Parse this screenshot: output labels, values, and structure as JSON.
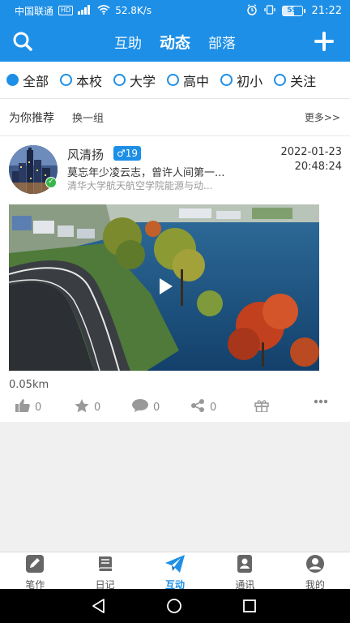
{
  "status_bar": {
    "carrier": "中国联通",
    "hd": "HD",
    "network": "4G",
    "speed": "52.8K/s",
    "battery": "59",
    "battery_level": 0.59,
    "time": "21:22"
  },
  "header": {
    "tabs": [
      {
        "label": "互助",
        "active": false
      },
      {
        "label": "动态",
        "active": true
      },
      {
        "label": "部落",
        "active": false
      }
    ],
    "left_icon": "search-icon",
    "right_icon": "plus-icon",
    "color": "#1e8fe6"
  },
  "filters": [
    {
      "label": "全部",
      "checked": true
    },
    {
      "label": "本校",
      "checked": false
    },
    {
      "label": "大学",
      "checked": false
    },
    {
      "label": "高中",
      "checked": false
    },
    {
      "label": "初小",
      "checked": false
    },
    {
      "label": "关注",
      "checked": false
    }
  ],
  "recommend": {
    "title": "为你推荐",
    "change": "换一组",
    "more": "更多>>"
  },
  "post": {
    "name": "风清扬",
    "gender": "♂",
    "age": "19",
    "signature": "莫忘年少凌云志，曾许人间第一...",
    "school": "清华大学航天航空学院能源与动...",
    "date": "2022-01-23",
    "time": "20:48:24",
    "distance": "0.05km",
    "actions": {
      "like": "0",
      "star": "0",
      "comment": "0",
      "share": "0"
    }
  },
  "tabbar": [
    {
      "label": "笔作",
      "icon": "edit-icon",
      "active": false
    },
    {
      "label": "日记",
      "icon": "book-icon",
      "active": false
    },
    {
      "label": "互动",
      "icon": "paper-plane-icon",
      "active": true
    },
    {
      "label": "通讯",
      "icon": "contacts-icon",
      "active": false
    },
    {
      "label": "我的",
      "icon": "user-icon",
      "active": false
    }
  ]
}
